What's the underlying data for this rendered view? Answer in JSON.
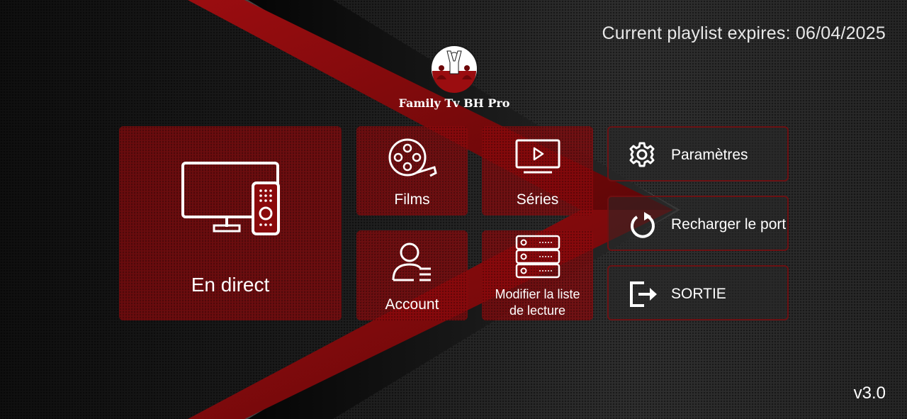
{
  "header": {
    "expiry_text": "Current playlist expires: 06/04/2025"
  },
  "logo": {
    "name": "Family Tv BH Pro"
  },
  "tiles": {
    "live": {
      "label": "En direct",
      "icon": "tv-remote-icon"
    },
    "films": {
      "label": "Films",
      "icon": "film-reel-icon"
    },
    "series": {
      "label": "Séries",
      "icon": "play-screen-icon"
    },
    "account": {
      "label": "Account",
      "icon": "user-icon"
    },
    "playlist": {
      "label_line1": "Modifier la liste",
      "label_line2": "de lecture",
      "icon": "server-stack-icon"
    }
  },
  "side_buttons": {
    "settings": {
      "label": "Paramètres",
      "icon": "gear-icon"
    },
    "reload": {
      "label": "Recharger le port",
      "icon": "reload-icon"
    },
    "exit": {
      "label": "SORTIE",
      "icon": "exit-icon"
    }
  },
  "footer": {
    "version": "v3.0"
  },
  "colors": {
    "accent_red": "#8a0a0c",
    "tile_bg": "rgba(138,10,12,0.72)",
    "button_border": "#780e10",
    "text": "#ffffff"
  }
}
